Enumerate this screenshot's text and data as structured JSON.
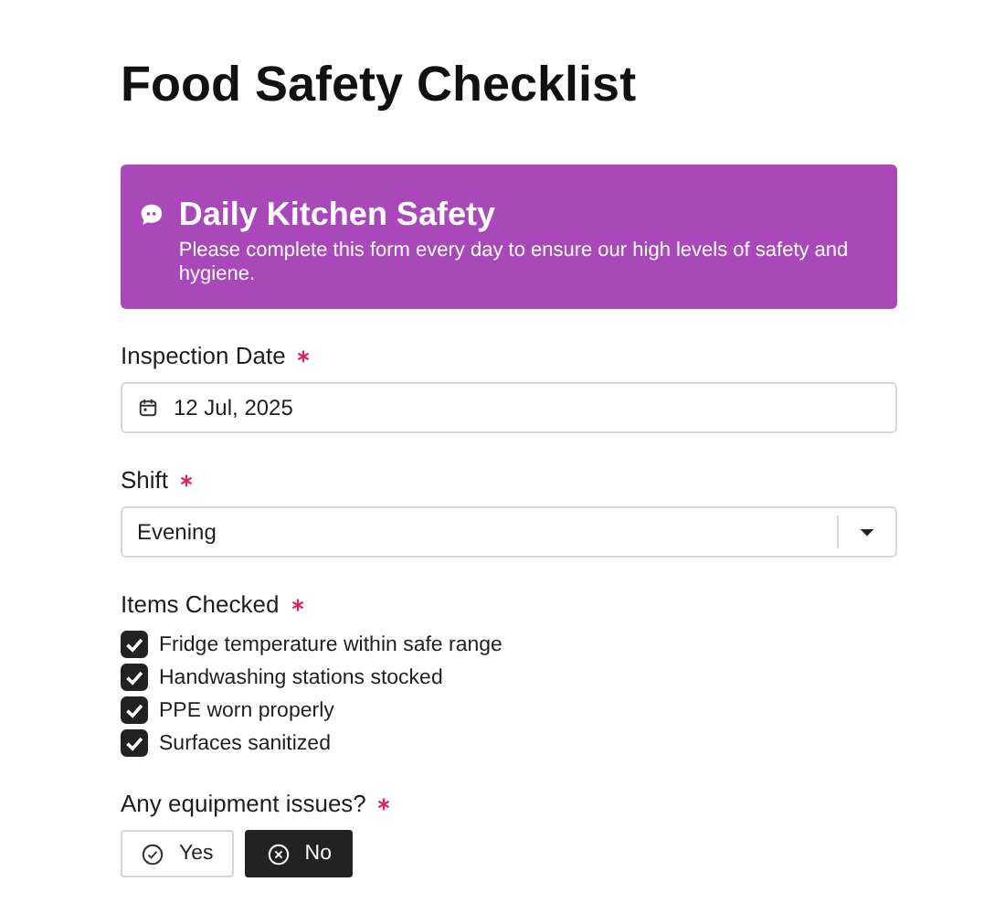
{
  "title": "Food Safety Checklist",
  "banner": {
    "heading": "Daily Kitchen Safety",
    "text": "Please complete this form every day to ensure our high levels of safety and hygiene."
  },
  "fields": [
    {
      "kind": "date",
      "label": "Inspection Date",
      "required": true,
      "value": "12 Jul, 2025"
    },
    {
      "kind": "select",
      "label": "Shift",
      "required": true,
      "value": "Evening"
    },
    {
      "kind": "checklist",
      "label": "Items Checked",
      "required": true,
      "options": [
        {
          "label": "Fridge temperature within safe range",
          "checked": true
        },
        {
          "label": "Handwashing stations stocked",
          "checked": true
        },
        {
          "label": "PPE worn properly",
          "checked": true
        },
        {
          "label": "Surfaces sanitized",
          "checked": true
        }
      ]
    },
    {
      "kind": "choice",
      "label": "Any equipment issues?",
      "required": true,
      "options": [
        {
          "label": "Yes",
          "kind": "check",
          "selected": false
        },
        {
          "label": "No",
          "kind": "cross",
          "selected": true
        }
      ]
    }
  ]
}
